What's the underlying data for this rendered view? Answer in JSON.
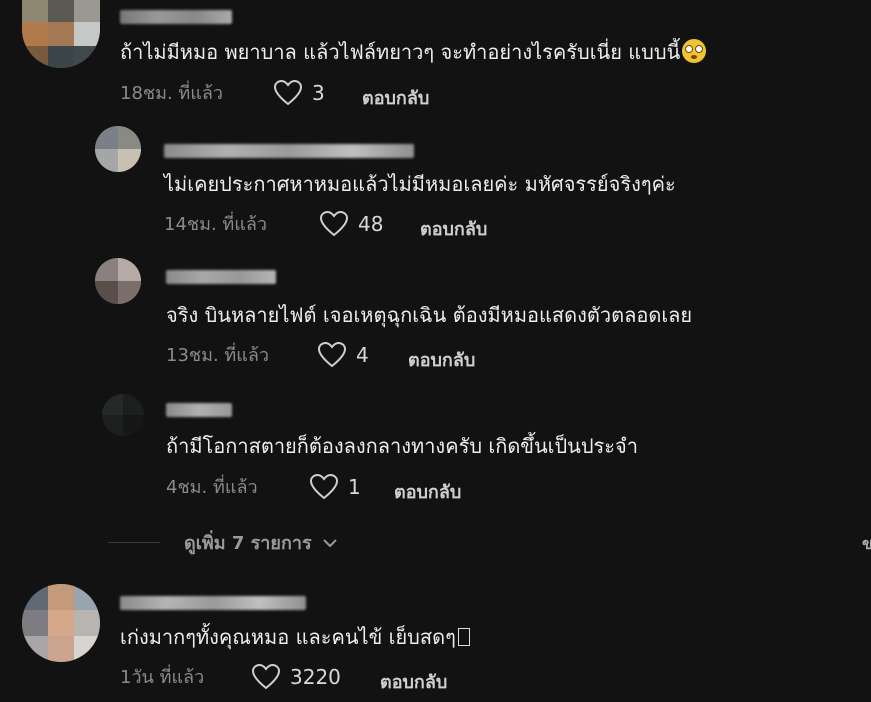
{
  "comments": [
    {
      "text": "ถ้าไม่มีหมอ พยาบาล แล้วไฟล์ทยาวๆ จะทำอย่างไรครับเนี่ย แบบนี้",
      "emoji": "flushed-face-emoji",
      "time": "18ชม. ที่แล้ว",
      "likes": "3",
      "reply": "ตอบกลับ"
    },
    {
      "text": "ไม่เคยประกาศหาหมอแล้วไม่มีหมอเลยค่ะ มหัศจรรย์จริงๆค่ะ",
      "time": "14ชม. ที่แล้ว",
      "likes": "48",
      "reply": "ตอบกลับ"
    },
    {
      "text": "จริง บินหลายไฟต์ เจอเหตุฉุกเฉิน ต้องมีหมอแสดงตัวตลอดเลย",
      "time": "13ชม. ที่แล้ว",
      "likes": "4",
      "reply": "ตอบกลับ"
    },
    {
      "text": "ถ้ามีโอกาสตายก็ต้องลงกลางทางครับ เกิดขึ้นเป็นประจำ",
      "time": "4ชม. ที่แล้ว",
      "likes": "1",
      "reply": "ตอบกลับ"
    },
    {
      "text": "เก่งมากๆทั้งคุณหมอ และคนไข้ เย็บสดๆ",
      "time": "1วัน ที่แล้ว",
      "likes": "3220",
      "reply": "ตอบกลับ"
    }
  ],
  "view_more": {
    "label": "ดูเพิ่ม 7 รายการ",
    "icon": "chevron-down-icon"
  },
  "edge_text": "ข",
  "colors": {
    "background": "#121212",
    "text": "#ededed",
    "meta": "#8a8a8a"
  }
}
